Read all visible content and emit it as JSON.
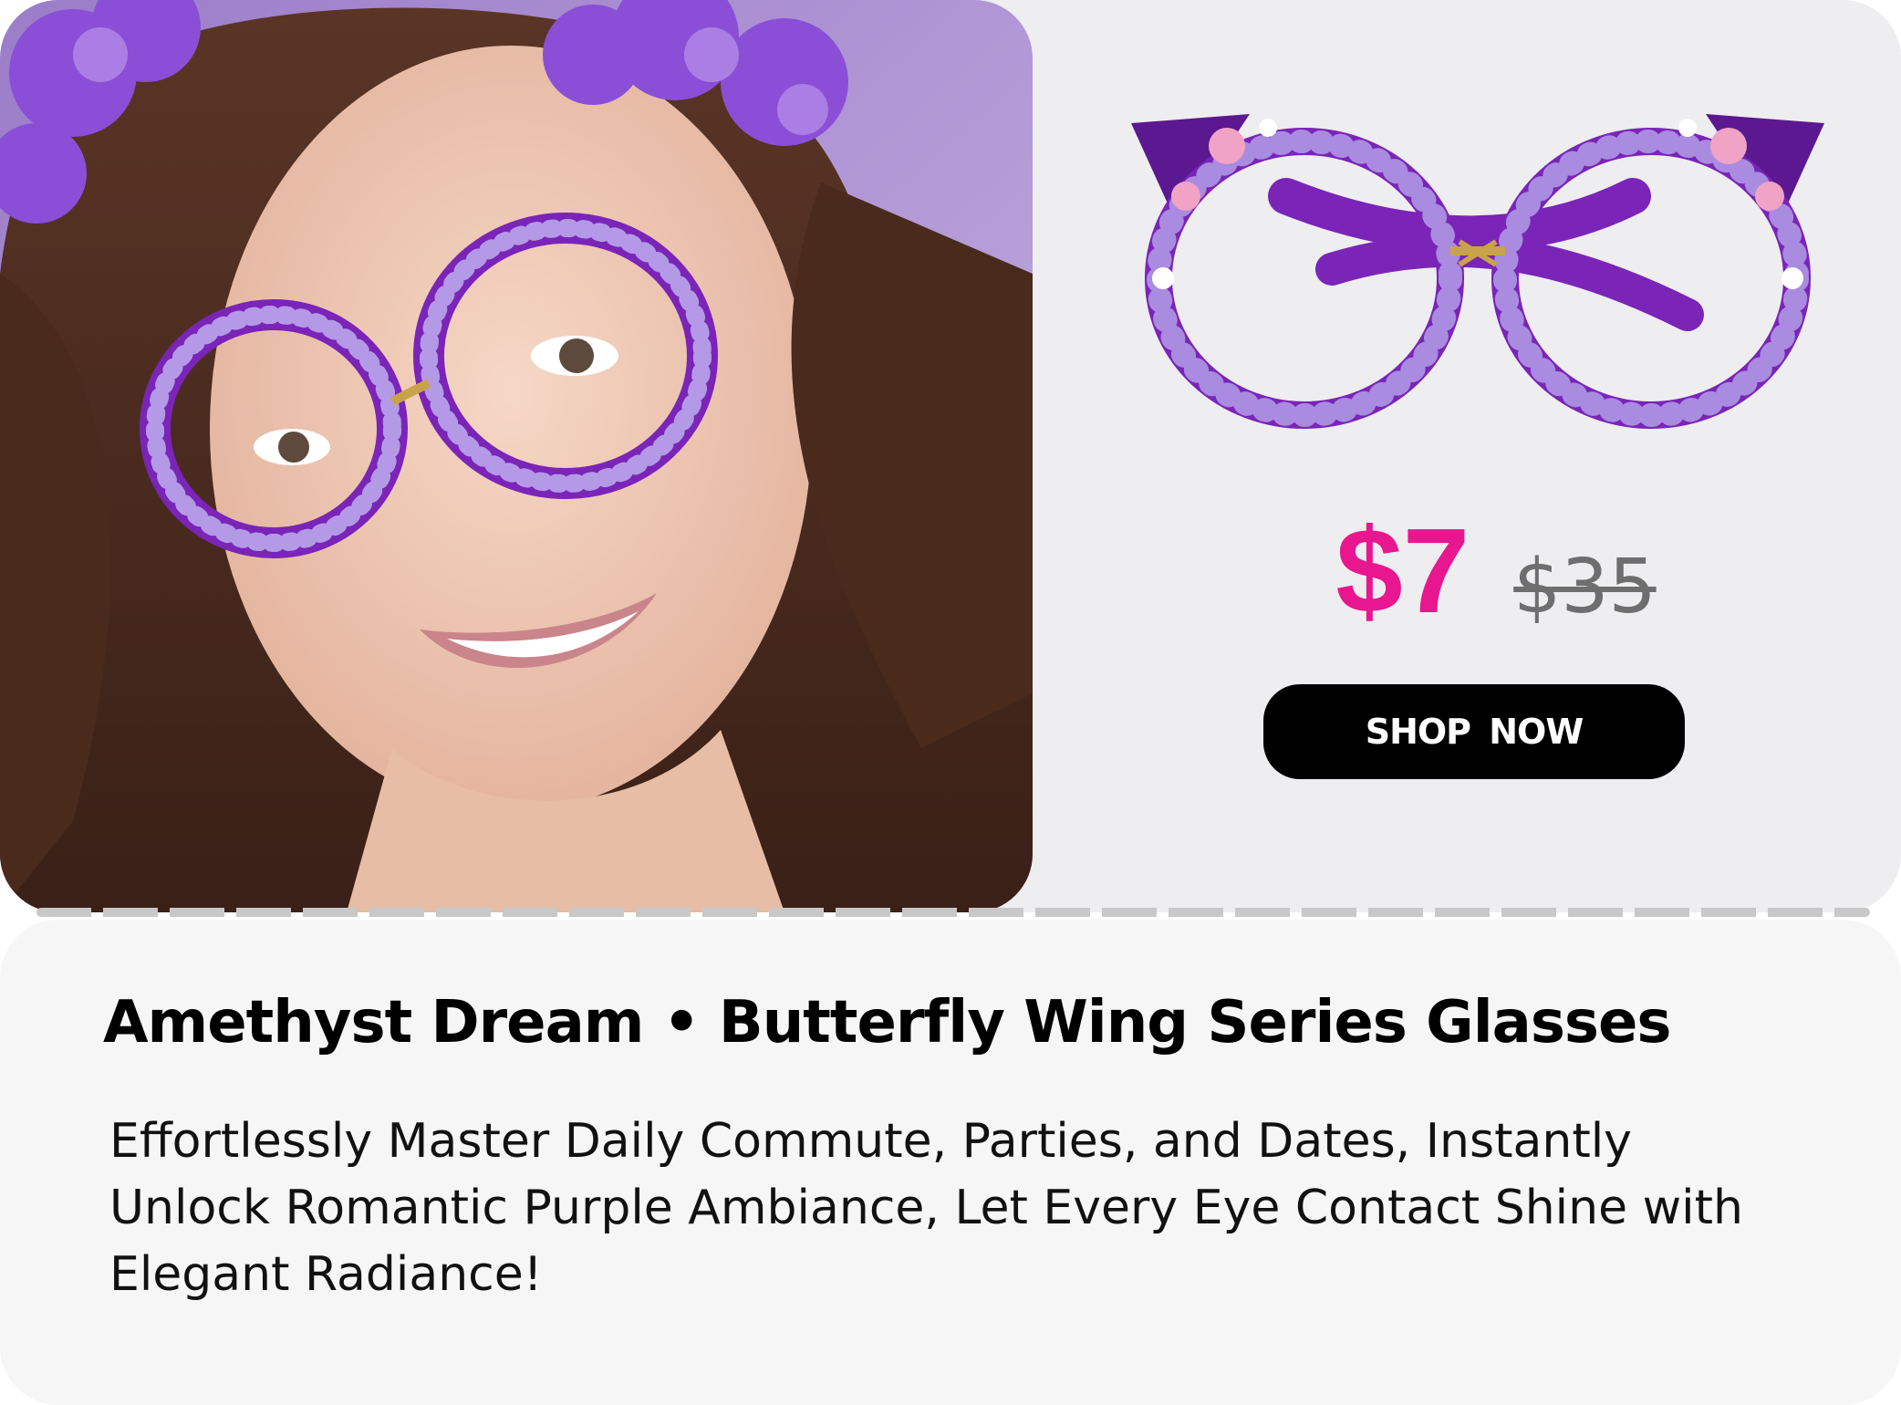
{
  "product": {
    "title": "Amethyst Dream • Butterfly Wing Series Glasses",
    "description": "Effortlessly Master Daily Commute, Parties, and Dates, Instantly Unlock Romantic Purple Ambiance, Let Every Eye Contact Shine with Elegant Radiance!",
    "price_current": "$7",
    "price_original": "$35",
    "cta_label": "SHOP NOW"
  },
  "colors": {
    "price_accent": "#e8168f",
    "button_bg": "#000000",
    "frame_purple": "#7a24b8",
    "rhinestone": "#a98be0"
  },
  "images": {
    "model_photo": "model-wearing-glasses-image",
    "product_photo": "glasses-product-image"
  }
}
